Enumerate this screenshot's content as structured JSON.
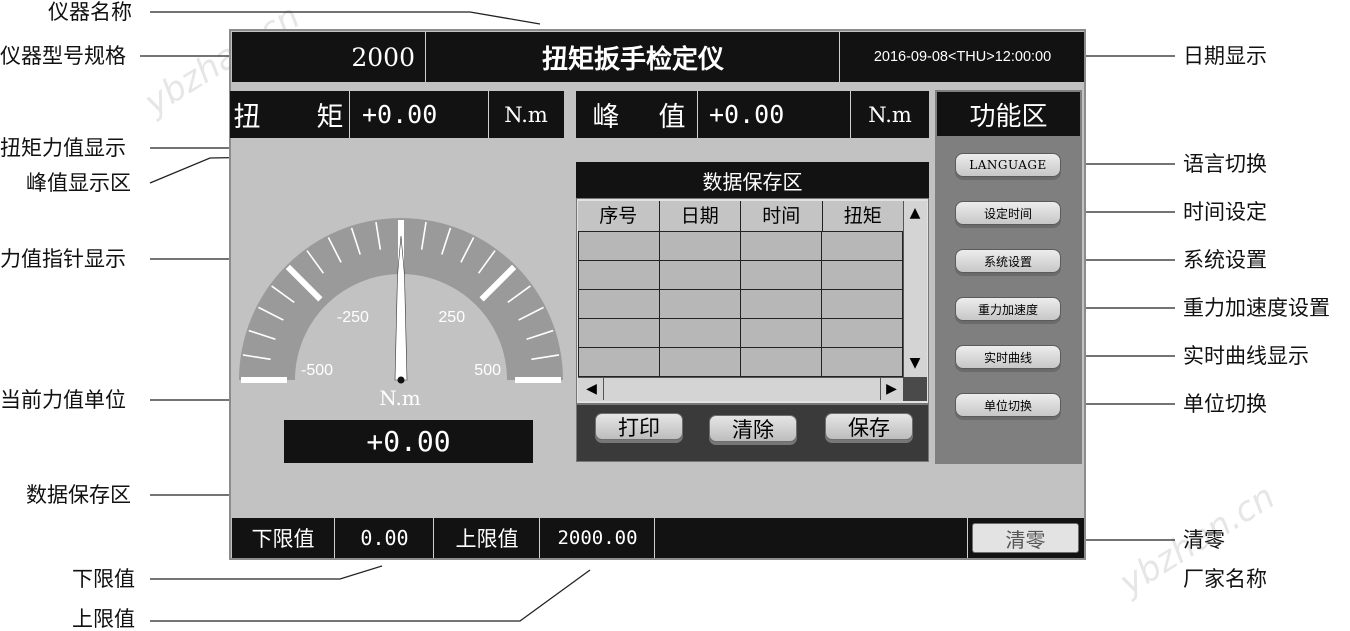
{
  "callouts": {
    "instrument_name": "仪器名称",
    "model_spec": "仪器型号规格",
    "torque_display": "扭矩力值显示",
    "peak_area": "峰值显示区",
    "pointer_display": "力值指针显示",
    "current_unit": "当前力值单位",
    "data_save_area": "数据保存区",
    "lower_limit": "下限值",
    "upper_limit": "上限值",
    "date_display": "日期显示",
    "language_switch": "语言切换",
    "time_setting": "时间设定",
    "system_settings": "系统设置",
    "gravity_setting": "重力加速度设置",
    "realtime_curve_display": "实时曲线显示",
    "unit_switch": "单位切换",
    "clear_zero": "清零",
    "manufacturer_name": "厂家名称"
  },
  "header": {
    "model": "2000",
    "title": "扭矩扳手检定仪",
    "datetime": "2016-09-08<THU>12:00:00"
  },
  "readouts": {
    "torque_label_1": "扭",
    "torque_label_2": "矩",
    "torque_value": "+0.00",
    "torque_unit": "N.m",
    "peak_label_1": "峰",
    "peak_label_2": "值",
    "peak_value": "+0.00",
    "peak_unit": "N.m"
  },
  "gauge": {
    "min": -500,
    "max": 500,
    "needle_value": 0,
    "tick_labels": [
      "-500",
      "-250",
      "250",
      "500"
    ],
    "unit": "N.m",
    "digital_value": "+0.00"
  },
  "data_table": {
    "title": "数据保存区",
    "columns": [
      "序号",
      "日期",
      "时间",
      "扭矩"
    ],
    "scroll_up": "▲",
    "scroll_down": "▼",
    "scroll_left": "◀",
    "scroll_right": "▶"
  },
  "actions": {
    "print": "打印",
    "clear": "清除",
    "save": "保存"
  },
  "function_area": {
    "title": "功能区",
    "buttons": [
      "LANGUAGE",
      "设定时间",
      "系统设置",
      "重力加速度",
      "实时曲线",
      "单位切换"
    ]
  },
  "footer": {
    "lower_label": "下限值",
    "lower_value": "0.00",
    "upper_label": "上限值",
    "upper_value": "2000.00",
    "zero_button": "清零"
  },
  "watermark": "ybzhan.cn",
  "colors": {
    "screen_bg": "#c2c2c2",
    "bar_bg": "#121212",
    "function_panel": "#7f7f7f",
    "gauge_arc": "#9a9a9a"
  }
}
